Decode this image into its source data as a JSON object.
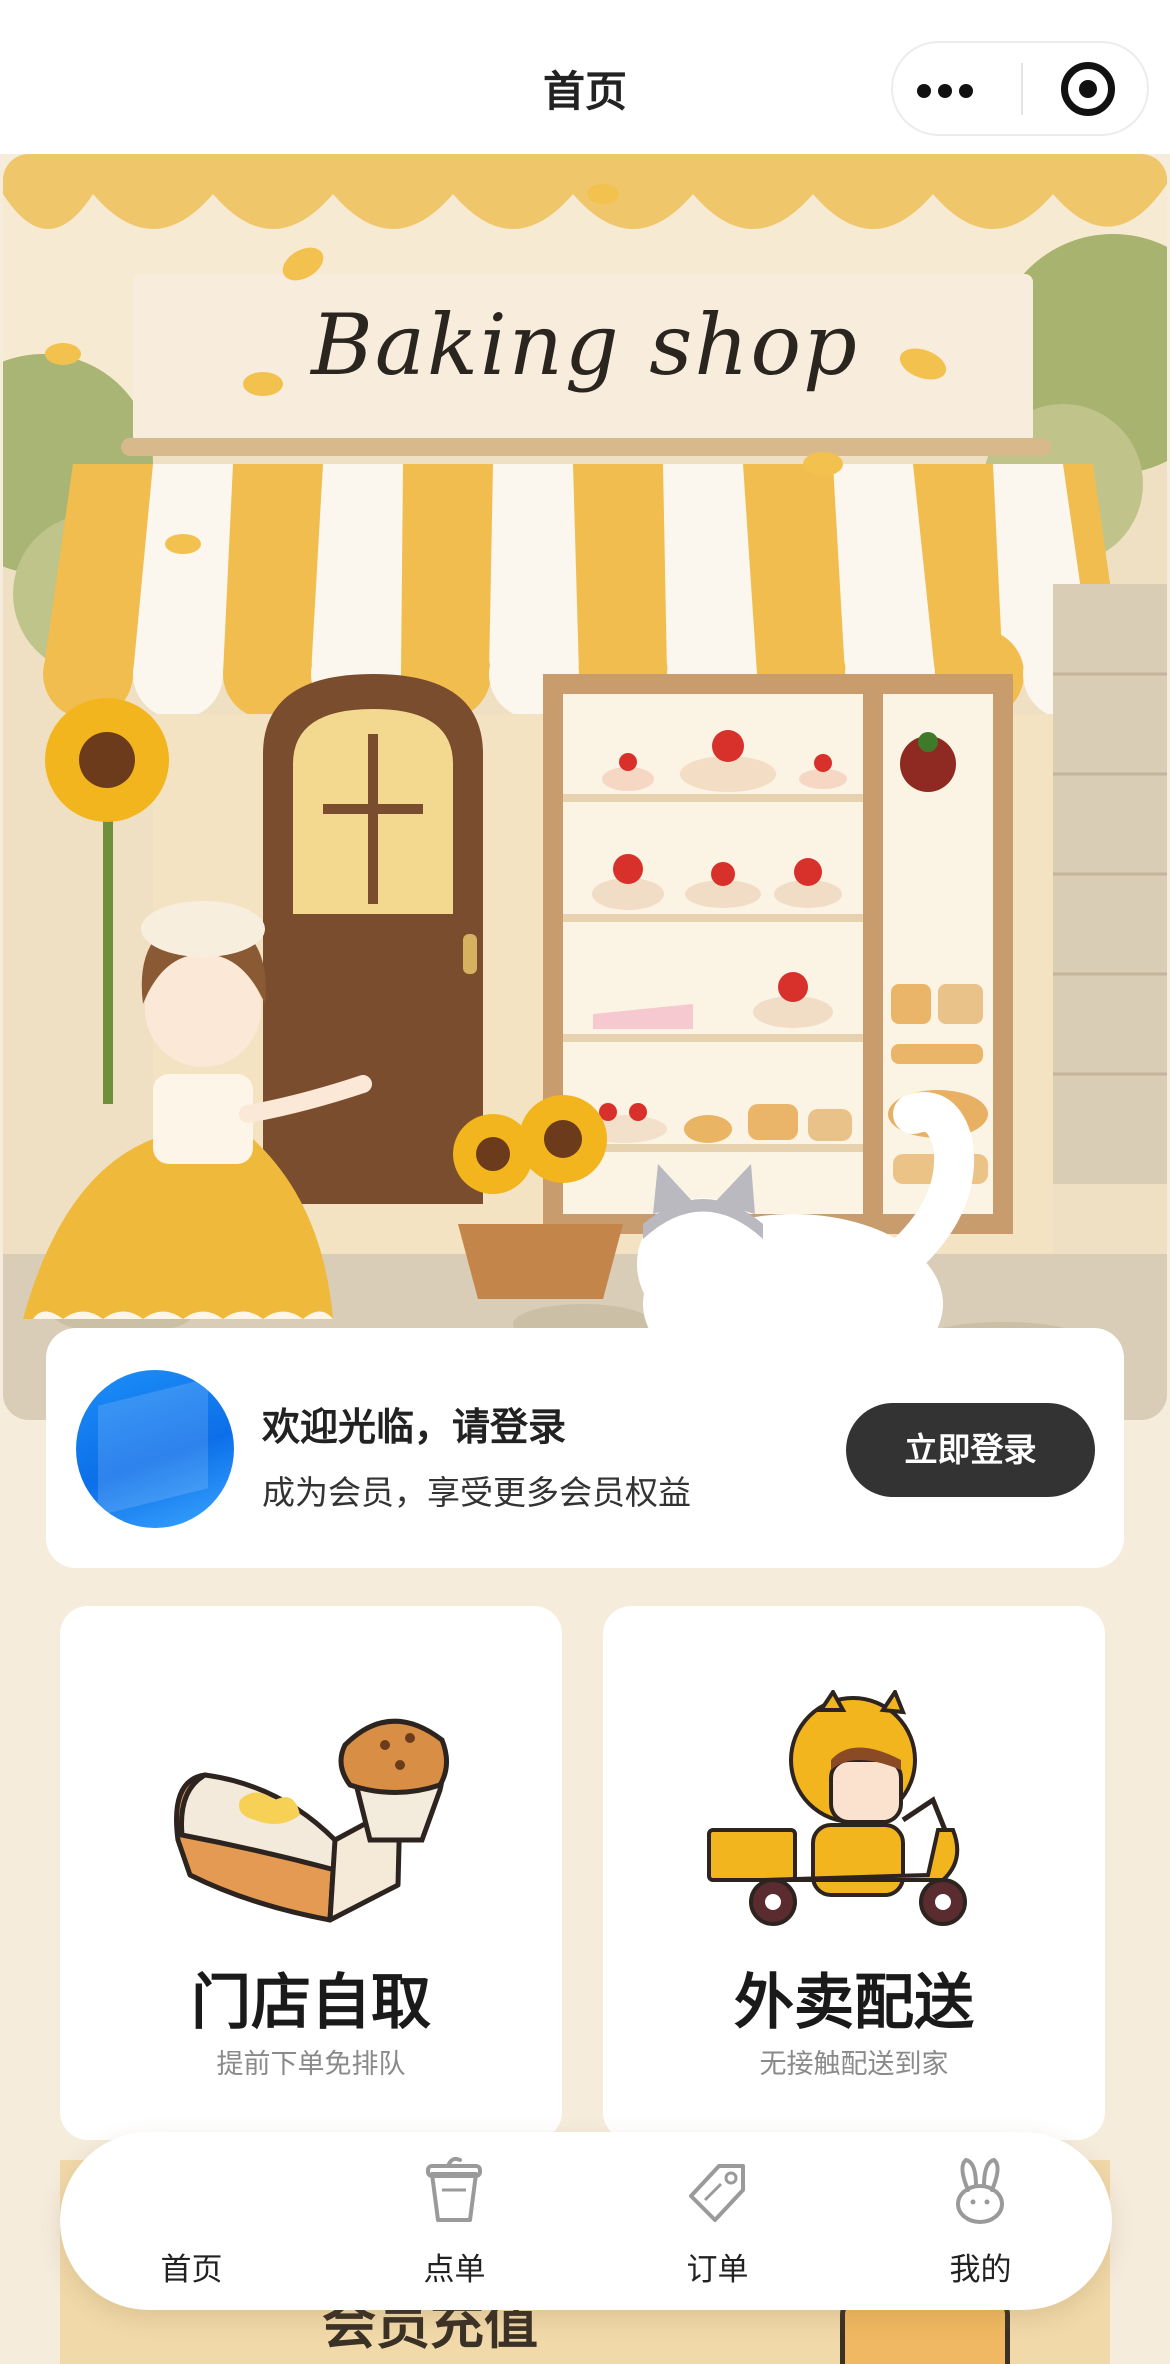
{
  "header": {
    "title": "首页",
    "more_icon": "more-dots-icon",
    "close_icon": "target-close-icon"
  },
  "hero": {
    "sign_text": "Baking shop",
    "colors": {
      "awning_yellow": "#f1bd4f",
      "awning_white": "#fbf7ee",
      "wall": "#f4e3c3",
      "door": "#7a4d2e"
    }
  },
  "login": {
    "welcome": "欢迎光临，请登录",
    "subtitle": "成为会员，享受更多会员权益",
    "button": "立即登录",
    "avatar_icon": "default-avatar-icon"
  },
  "services": [
    {
      "title": "门店自取",
      "subtitle": "提前下单免排队",
      "icon": "cake-slice-icon"
    },
    {
      "title": "外卖配送",
      "subtitle": "无接触配送到家",
      "icon": "delivery-scooter-icon"
    }
  ],
  "member_peek": {
    "title": "会员充值"
  },
  "tabbar": {
    "items": [
      {
        "label": "首页",
        "icon": "home-icon",
        "active": true
      },
      {
        "label": "点单",
        "icon": "cup-icon",
        "active": false
      },
      {
        "label": "订单",
        "icon": "tag-icon",
        "active": false
      },
      {
        "label": "我的",
        "icon": "bunny-icon",
        "active": false
      }
    ]
  },
  "colors": {
    "page_bg": "#f6ecdc",
    "accent_dark": "#333333",
    "card_bg": "#ffffff"
  }
}
